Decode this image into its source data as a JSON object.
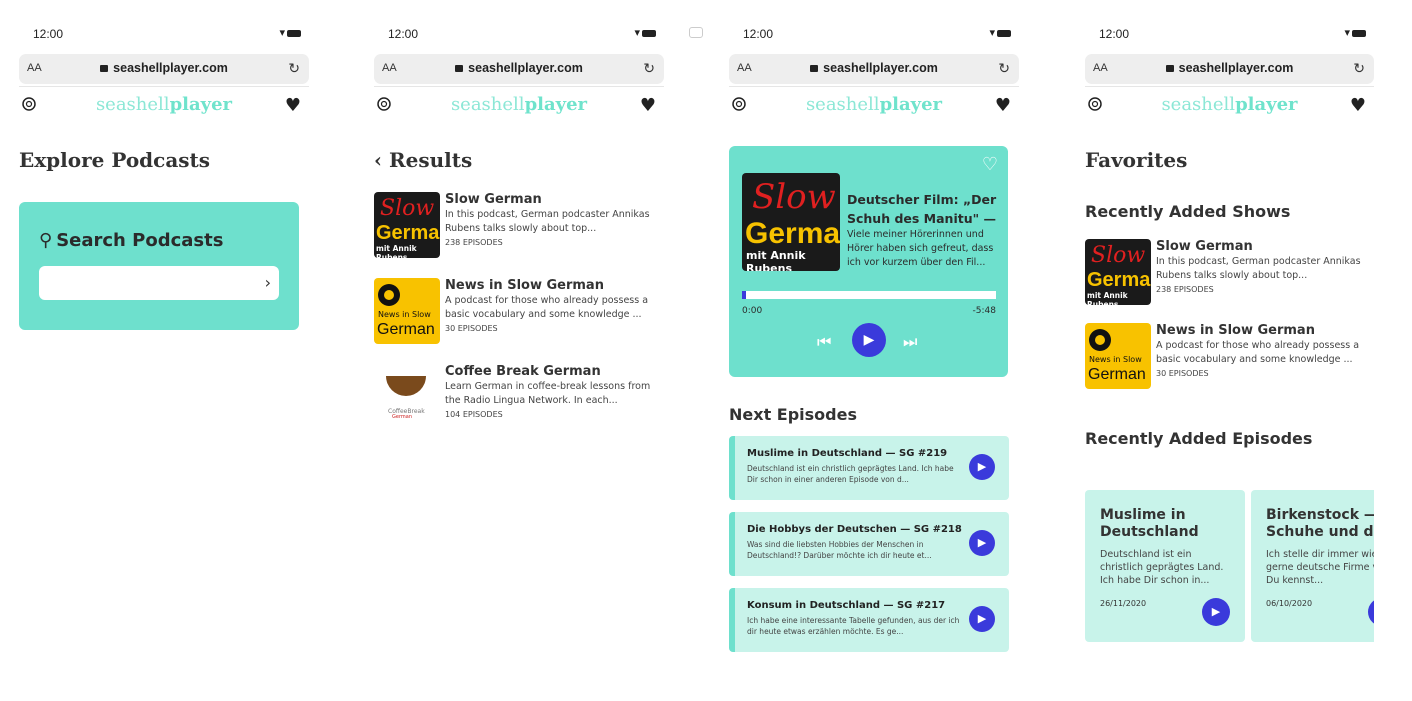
{
  "browser": {
    "time": "12:00",
    "text_size": "AA",
    "url": "seashellplayer.com"
  },
  "app": {
    "logo_light": "seashell",
    "logo_bold": "player"
  },
  "explore": {
    "title": "Explore Podcasts",
    "search_title": "Search Podcasts",
    "search_value": ""
  },
  "results": {
    "back_title": "Results",
    "items": [
      {
        "title": "Slow German",
        "desc": "In this podcast, German podcaster Annikas Rubens talks slowly about top...",
        "count": "238 EPISODES"
      },
      {
        "title": "News in Slow German",
        "desc": "A podcast for those who already possess a basic vocabulary and some knowledge ...",
        "count": "30 EPISODES"
      },
      {
        "title": "Coffee Break German",
        "desc": "Learn German in coffee-break lessons from the Radio Lingua Network. In each...",
        "count": "104 EPISODES"
      }
    ]
  },
  "art": {
    "slow_1": "Slow",
    "slow_2": "German",
    "slow_3": "mit Annik Rubens",
    "nsg_1": "News in Slow",
    "nsg_2": "German",
    "cbg_1": "CoffeeBreak",
    "cbg_2": "German"
  },
  "player": {
    "episode_title": "Deutscher Film: „Der Schuh des Manitu\" —",
    "episode_desc": "Viele meiner Hörerinnen und Hörer haben sich gefreut, dass ich vor kurzem über den Fil...",
    "time_start": "0:00",
    "time_end": "-5:48",
    "progress": 0.015,
    "next_title": "Next Episodes",
    "next": [
      {
        "title": "Muslime in Deutschland — SG #219",
        "desc": "Deutschland ist ein christlich geprägtes Land. Ich habe Dir schon in einer anderen Episode von d..."
      },
      {
        "title": "Die Hobbys der Deutschen — SG #218",
        "desc": "Was sind die liebsten Hobbies der Menschen in Deutschland!? Darüber möchte ich dir heute et..."
      },
      {
        "title": "Konsum in Deutschland — SG #217",
        "desc": "Ich habe eine interessante Tabelle gefunden, aus der ich dir heute etwas erzählen möchte. Es ge..."
      }
    ]
  },
  "favorites": {
    "title": "Favorites",
    "shows_title": "Recently Added Shows",
    "episodes_title": "Recently Added Episodes",
    "episodes": [
      {
        "title": "Muslime in Deutschland",
        "desc": "Deutschland ist ein christlich geprägtes Land. Ich habe Dir schon in...",
        "date": "26/11/2020"
      },
      {
        "title": "Birkenstock — Schuhe und die",
        "desc": "Ich stelle dir immer wieder gerne deutsche Firme vor. Du kennst...",
        "date": "06/10/2020"
      }
    ]
  },
  "colors": {
    "accent": "#6ee0cd",
    "accent_light": "#c8f3ea",
    "play": "#3a3adb"
  }
}
